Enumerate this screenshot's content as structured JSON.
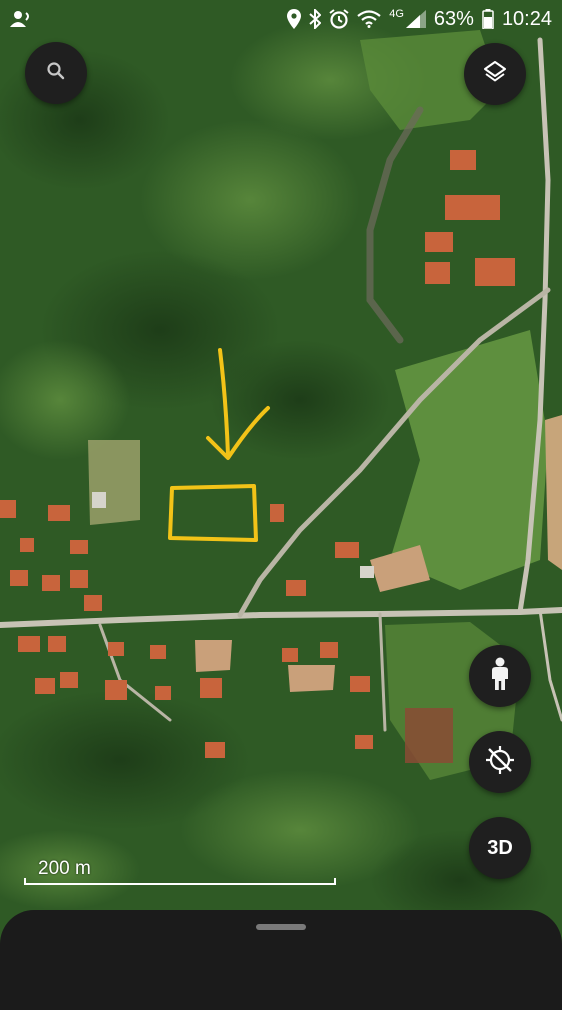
{
  "status_bar": {
    "network_label": "4G",
    "battery_percent": "63%",
    "time": "10:24",
    "icons": [
      "user-sync-icon",
      "location-icon",
      "bluetooth-icon",
      "alarm-icon",
      "wifi-icon",
      "signal-icon",
      "battery-icon"
    ]
  },
  "map": {
    "type": "satellite",
    "scale_label": "200 m",
    "colors": {
      "forest": "#2f5a25",
      "field": "#5f8d3d",
      "road": "#c7c3b5",
      "roof": "#c8643c",
      "annotation": "#f2c318"
    },
    "annotation": "hand-drawn yellow arrow pointing down to a yellow rectangle outlining a plot"
  },
  "controls": {
    "search": {
      "icon": "search-icon"
    },
    "layers": {
      "icon": "layers-icon"
    },
    "street_view": {
      "icon": "pegman-icon"
    },
    "orientation": {
      "icon": "compass-reset-icon"
    },
    "three_d": {
      "label": "3D"
    }
  },
  "sheet": {
    "handle": "drag-handle"
  }
}
